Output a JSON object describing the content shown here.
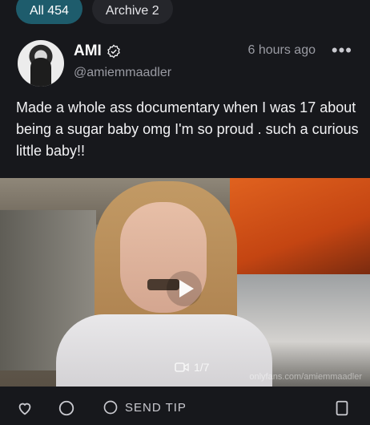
{
  "tabs": [
    {
      "label": "All 454",
      "active": true
    },
    {
      "label": "Archive 2",
      "active": false
    }
  ],
  "post": {
    "author_name": "AMI",
    "handle": "@amiemmaadler",
    "time": "6 hours ago",
    "more_icon": "more-dots-icon",
    "verified_icon": "verified-badge-icon",
    "text": "Made a whole ass documentary when I was 17 about being a sugar baby omg I'm so proud . such a curious little baby!!"
  },
  "media": {
    "play_icon": "play-icon",
    "counter": "1/7",
    "counter_icon": "video-icon",
    "watermark": "onlyfans.com/amiemmaadler"
  },
  "actions": {
    "send_tip": "SEND TIP",
    "like_icon": "heart-icon",
    "comment_icon": "comment-icon",
    "tip_icon": "dollar-icon",
    "bookmark_icon": "bookmark-icon"
  },
  "colors": {
    "background": "#17181c",
    "active_tab": "#1e5c6c",
    "muted_text": "#9a9ba3"
  }
}
